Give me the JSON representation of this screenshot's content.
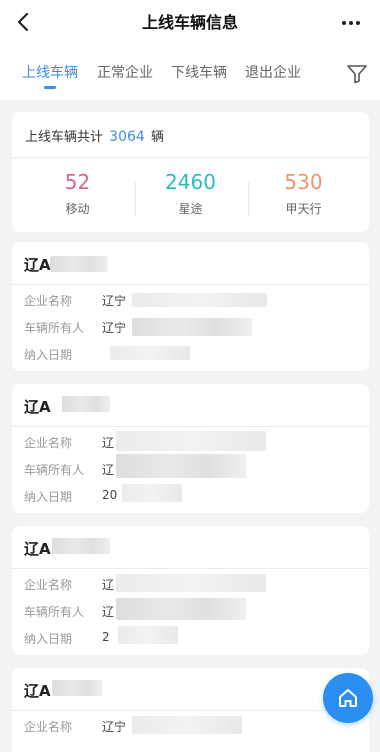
{
  "header": {
    "title": "上线车辆信息"
  },
  "tabs": [
    {
      "label": "上线车辆",
      "active": true
    },
    {
      "label": "正常企业",
      "active": false
    },
    {
      "label": "下线车辆",
      "active": false
    },
    {
      "label": "退出企业",
      "active": false
    }
  ],
  "summary": {
    "prefix": "上线车辆共计",
    "total": "3064",
    "unit": "辆",
    "stats": [
      {
        "value": "52",
        "label": "移动",
        "color": "#e0628a"
      },
      {
        "value": "2460",
        "label": "星途",
        "color": "#2bbcc0"
      },
      {
        "value": "530",
        "label": "甲天行",
        "color": "#f0956a"
      }
    ]
  },
  "card_labels": {
    "company": "企业名称",
    "owner": "车辆所有人",
    "date": "纳入日期"
  },
  "cards": [
    {
      "plate": "辽A",
      "company": "辽宁",
      "owner": "辽宁",
      "date": ""
    },
    {
      "plate": "辽A",
      "company": "辽",
      "owner": "辽",
      "date": "20"
    },
    {
      "plate": "辽A",
      "company": "辽",
      "owner": "辽",
      "date": "2"
    },
    {
      "plate": "辽A",
      "company": "辽宁",
      "owner": "",
      "date": ""
    }
  ],
  "colors": {
    "accent": "#3a8ee6",
    "fab": "#2b8ff2"
  },
  "icons": {
    "back": "back-arrow-icon",
    "more": "more-dots-icon",
    "filter": "filter-funnel-icon",
    "home": "home-icon"
  }
}
